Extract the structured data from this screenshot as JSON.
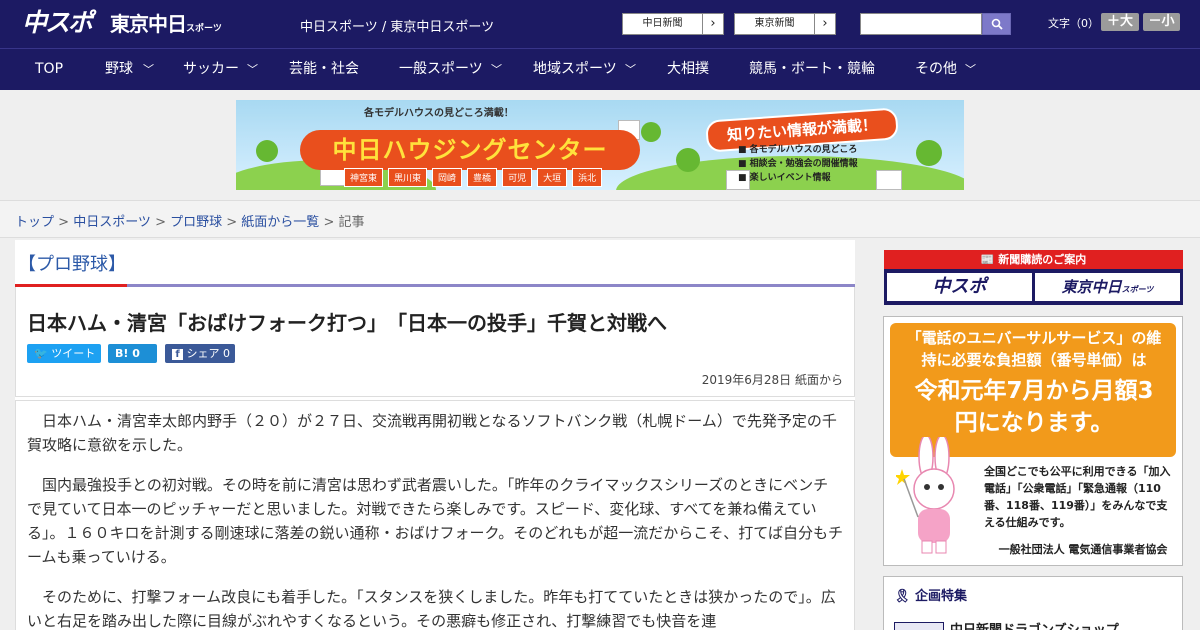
{
  "header": {
    "logo_chuspo": "中スポ",
    "logo_tokyo": "東京中日",
    "logo_tokyo_small": "スポーツ",
    "site_names": "中日スポーツ / 東京中日スポーツ",
    "btn_chunichi": "中日新聞",
    "btn_tokyo": "東京新聞",
    "search_placeholder": "",
    "font_label": "文字（0）",
    "font_up": "＋大",
    "font_down": "－小",
    "bg_color": "#1c1a63"
  },
  "nav": [
    {
      "label": "TOP",
      "chevron": false
    },
    {
      "label": "野球",
      "chevron": true
    },
    {
      "label": "サッカー",
      "chevron": true
    },
    {
      "label": "芸能・社会",
      "chevron": false
    },
    {
      "label": "一般スポーツ",
      "chevron": true
    },
    {
      "label": "地域スポーツ",
      "chevron": true
    },
    {
      "label": "大相撲",
      "chevron": false
    },
    {
      "label": "競馬・ボート・競輪",
      "chevron": false
    },
    {
      "label": "その他",
      "chevron": true
    }
  ],
  "banner": {
    "tagline": "各モデルハウスの見どころ満載！",
    "title": "中日ハウジングセンター",
    "headline": "知りたい情報が満載！",
    "features": [
      "各モデルハウスの見どころ",
      "相談会・勉強会の開催情報",
      "楽しいイベント情報"
    ],
    "towns": [
      "神宮東",
      "黒川東",
      "岡崎",
      "豊橋",
      "可児",
      "大垣",
      "浜北"
    ]
  },
  "breadcrumb": {
    "items": [
      "トップ",
      "中日スポーツ",
      "プロ野球",
      "紙面から一覧"
    ],
    "current": "記事",
    "sep": " > "
  },
  "article": {
    "category": "【プロ野球】",
    "title": "日本ハム・清宮「おばけフォーク打つ」　「日本一の投手」千賀と対戦へ",
    "share_tweet": "ツイート",
    "share_hatena": "B!",
    "share_hatena_count": "0",
    "share_fb": "シェア",
    "share_fb_count": "0",
    "date": "2019年6月28日 紙面から",
    "paragraphs": [
      "日本ハム・清宮幸太郎内野手（２０）が２７日、交流戦再開初戦となるソフトバンク戦（札幌ドーム）で先発予定の千賀攻略に意欲を示した。",
      "国内最強投手との初対戦。その時を前に清宮は思わず武者震いした。「昨年のクライマックスシリーズのときにベンチで見ていて日本一のピッチャーだと思いました。対戦できたら楽しみです。スピード、変化球、すべてを兼ね備えている」。１６０キロを計測する剛速球に落差の鋭い通称・おばけフォーク。そのどれもが超一流だからこそ、打てば自分もチームも乗っていける。",
      "そのために、打撃フォーム改良にも着手した。「スタンスを狭くしました。昨年も打てていたときは狭かったので」。広いと右足を踏み出した際に目線がぶれやすくなるという。その悪癖も修正され、打撃練習でも快音を連"
    ]
  },
  "sidebar": {
    "sub_header": "新聞購読のご案内",
    "sub_chuspo": "中スポ",
    "sub_tokyo": "東京中日",
    "sub_tokyo_small": "スポーツ",
    "ad_line1": "「電話のユニバーサルサービス」の維持に必要な負担額（番号単価）は",
    "ad_line2": "令和元年7月から月額3円になります。",
    "ad_line3": "全国どこでも公平に利用できる「加入電話」「公衆電話」「緊急通報（110番、118番、119番）」をみんなで支える仕組みです。",
    "ad_line4": "一般社団法人 電気通信事業者協会",
    "kikaku_header": "企画特集",
    "kikaku_item": "中日新聞ドラゴンズショップ"
  }
}
